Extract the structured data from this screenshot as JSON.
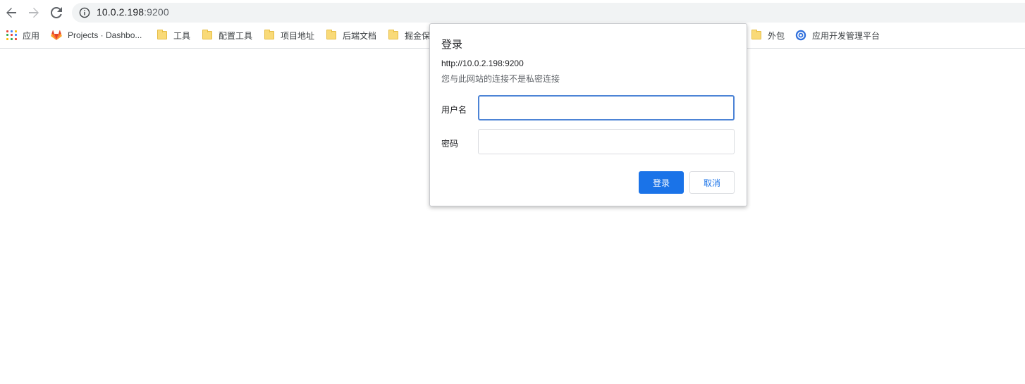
{
  "omnibox": {
    "url_host": "10.0.2.198",
    "url_port": ":9200"
  },
  "bookmarks": [
    {
      "label": "应用",
      "icon": "apps-grid-icon"
    },
    {
      "label": "Projects · Dashbo...",
      "icon": "gitlab-icon"
    },
    {
      "label": "工具",
      "icon": "folder-icon"
    },
    {
      "label": "配置工具",
      "icon": "folder-icon"
    },
    {
      "label": "项目地址",
      "icon": "folder-icon"
    },
    {
      "label": "后端文档",
      "icon": "folder-icon"
    },
    {
      "label": "掘金保",
      "icon": "folder-icon"
    },
    {
      "label": "外包",
      "icon": "folder-icon"
    },
    {
      "label": "应用开发管理平台",
      "icon": "target-icon"
    }
  ],
  "dialog": {
    "title": "登录",
    "host": "http://10.0.2.198:9200",
    "warning": "您与此网站的连接不是私密连接",
    "username_label": "用户名",
    "username_value": "",
    "password_label": "密码",
    "password_value": "",
    "login_button": "登录",
    "cancel_button": "取消"
  },
  "colors": {
    "primary": "#1a73e8",
    "focus_border": "#4d84d6",
    "omnibox_bg": "#f1f3f4",
    "folder": "#f9da78"
  }
}
